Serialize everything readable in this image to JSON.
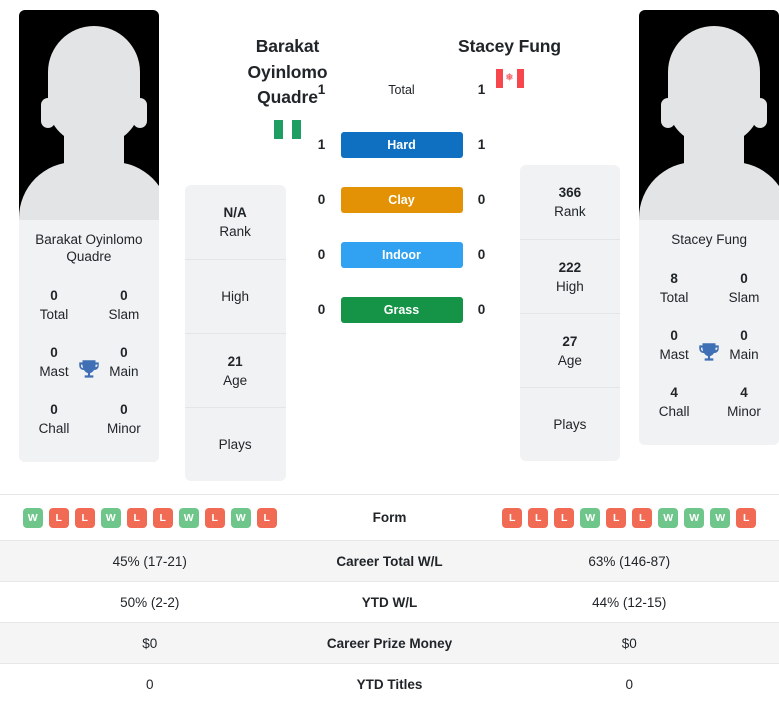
{
  "players": {
    "left": {
      "display_name": "Barakat Oyinlomo Quadre",
      "name_lines": [
        "Barakat",
        "Oyinlomo",
        "Quadre"
      ],
      "card_name": "Barakat Oyinlomo Quadre",
      "country": "Nigeria",
      "flag_icon": "nigeria-flag-icon",
      "avatar_icon": "player-avatar-placeholder-icon",
      "titles": [
        {
          "value": "0",
          "label": "Total"
        },
        {
          "value": "0",
          "label": "Slam"
        },
        {
          "value": "0",
          "label": "Mast"
        },
        {
          "value": "0",
          "label": "Main"
        },
        {
          "value": "0",
          "label": "Chall"
        },
        {
          "value": "0",
          "label": "Minor"
        }
      ],
      "info": [
        {
          "value": "N/A",
          "label": "Rank"
        },
        {
          "value": "",
          "label": "High"
        },
        {
          "value": "21",
          "label": "Age"
        },
        {
          "value": "",
          "label": "Plays"
        }
      ],
      "form": [
        "W",
        "L",
        "L",
        "W",
        "L",
        "L",
        "W",
        "L",
        "W",
        "L"
      ],
      "career_total_wl": "45% (17-21)",
      "ytd_wl": "50% (2-2)",
      "career_prize_money": "$0",
      "ytd_titles": "0"
    },
    "right": {
      "display_name": "Stacey Fung",
      "name_lines": [
        "Stacey Fung"
      ],
      "card_name": "Stacey Fung",
      "country": "Canada",
      "flag_icon": "canada-flag-icon",
      "avatar_icon": "player-avatar-placeholder-icon",
      "titles": [
        {
          "value": "8",
          "label": "Total"
        },
        {
          "value": "0",
          "label": "Slam"
        },
        {
          "value": "0",
          "label": "Mast"
        },
        {
          "value": "0",
          "label": "Main"
        },
        {
          "value": "4",
          "label": "Chall"
        },
        {
          "value": "4",
          "label": "Minor"
        }
      ],
      "info": [
        {
          "value": "366",
          "label": "Rank"
        },
        {
          "value": "222",
          "label": "High"
        },
        {
          "value": "27",
          "label": "Age"
        },
        {
          "value": "",
          "label": "Plays"
        }
      ],
      "form": [
        "L",
        "L",
        "L",
        "W",
        "L",
        "L",
        "W",
        "W",
        "W",
        "L"
      ],
      "career_total_wl": "63% (146-87)",
      "ytd_wl": "44% (12-15)",
      "career_prize_money": "$0",
      "ytd_titles": "0"
    }
  },
  "head_to_head": {
    "surfaces": [
      {
        "label": "Total",
        "left": "1",
        "right": "1",
        "color": "transparent",
        "style": "plain"
      },
      {
        "label": "Hard",
        "left": "1",
        "right": "1",
        "color": "#0f6fc0",
        "style": "pill"
      },
      {
        "label": "Clay",
        "left": "0",
        "right": "0",
        "color": "#e39205",
        "style": "pill"
      },
      {
        "label": "Indoor",
        "left": "0",
        "right": "0",
        "color": "#31a2f2",
        "style": "pill"
      },
      {
        "label": "Grass",
        "left": "0",
        "right": "0",
        "color": "#159447",
        "style": "pill"
      }
    ]
  },
  "comparison_table": {
    "rows": [
      {
        "key": "form",
        "label": "Form"
      },
      {
        "key": "career_total_wl",
        "label": "Career Total W/L"
      },
      {
        "key": "ytd_wl",
        "label": "YTD W/L"
      },
      {
        "key": "career_prize_money",
        "label": "Career Prize Money"
      },
      {
        "key": "ytd_titles",
        "label": "YTD Titles"
      }
    ]
  },
  "colors": {
    "hard": "#0f6fc0",
    "clay": "#e39205",
    "indoor": "#31a2f2",
    "grass": "#159447",
    "win_badge": "#6fc68a",
    "loss_badge": "#f06a54",
    "trophy": "#3f6fb5",
    "card_bg": "#f1f2f3"
  },
  "icons": {
    "trophy": "trophy-icon",
    "maple_leaf": "maple-leaf-icon"
  }
}
